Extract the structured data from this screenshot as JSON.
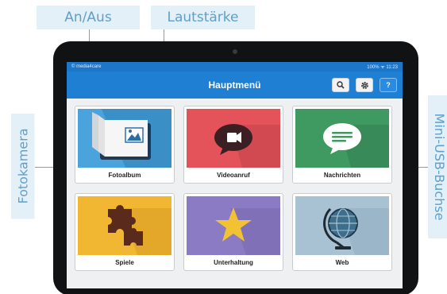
{
  "callouts": {
    "power": "An/Aus",
    "volume": "Lautstärke",
    "camera": "Fotokamera",
    "usb": "Mini-USB-Buchse"
  },
  "statusbar": {
    "brand": "© media4care",
    "status": "100% ᯤ 11:23"
  },
  "header": {
    "title": "Hauptmenü",
    "search_icon": "search-icon",
    "settings_icon": "gear-icon",
    "help_label": "?"
  },
  "tiles": [
    {
      "label": "Fotoalbum",
      "color": "#4aa3dd",
      "icon": "photo-album-icon"
    },
    {
      "label": "Videoanruf",
      "color": "#e4535a",
      "icon": "video-camera-icon"
    },
    {
      "label": "Nachrichten",
      "color": "#3f9a62",
      "icon": "message-icon"
    },
    {
      "label": "Spiele",
      "color": "#f1b733",
      "icon": "puzzle-icon"
    },
    {
      "label": "Unterhaltung",
      "color": "#8b7bc4",
      "icon": "star-icon"
    },
    {
      "label": "Web",
      "color": "#a9c2d3",
      "icon": "globe-icon"
    }
  ],
  "colors": {
    "header_blue": "#1f7fd3",
    "callout_text": "#5f9fc9",
    "callout_bg": "#e3f0f8",
    "tablet_body": "#111214"
  }
}
